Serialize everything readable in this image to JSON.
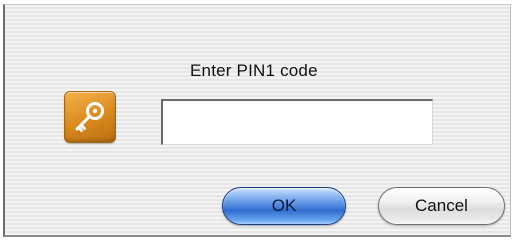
{
  "dialog": {
    "prompt": "Enter PIN1 code",
    "icon": "key-icon",
    "pin_input": {
      "value": "",
      "placeholder": ""
    },
    "buttons": {
      "ok_label": "OK",
      "cancel_label": "Cancel"
    }
  },
  "colors": {
    "ok_button": "#4d86de",
    "key_icon_bg": "#d98a1c"
  }
}
